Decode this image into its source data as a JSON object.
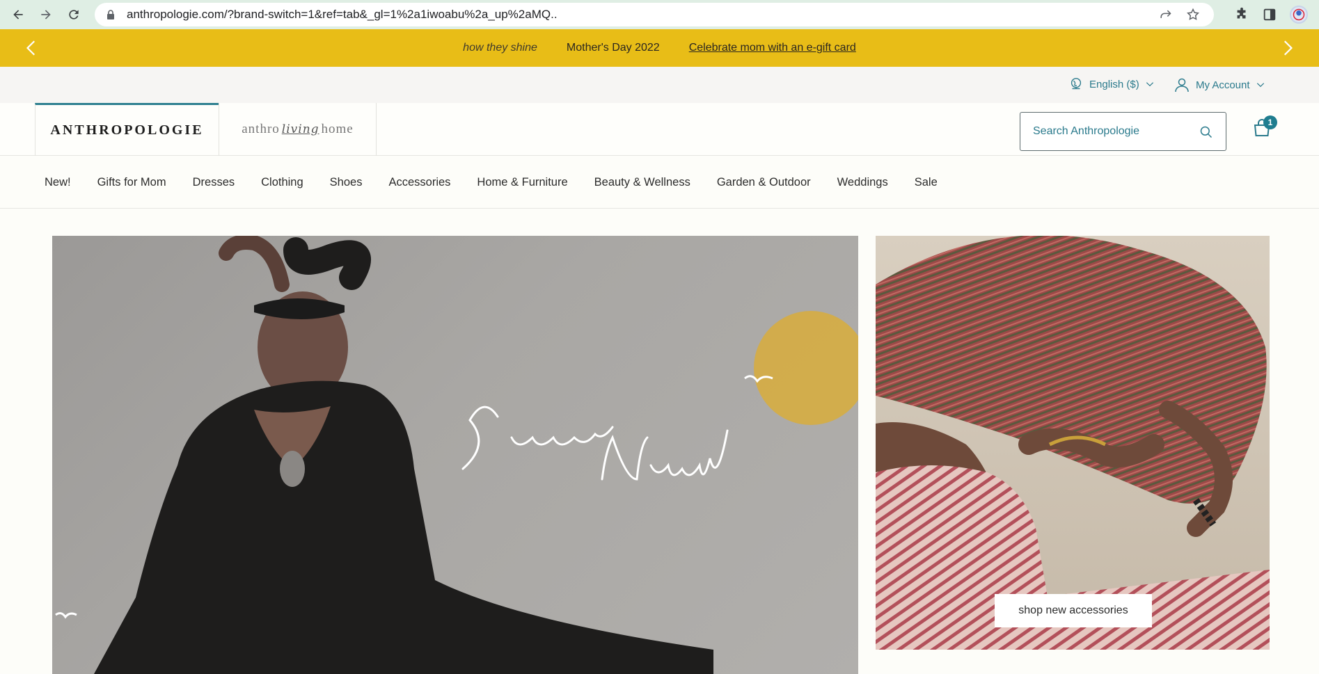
{
  "browser": {
    "url": "anthropologie.com/?brand-switch=1&ref=tab&_gl=1%2a1iwoabu%2a_up%2aMQ.."
  },
  "promo": {
    "items": [
      {
        "label": "how they shine"
      },
      {
        "label": "Mother's Day 2022"
      },
      {
        "label": "Celebrate mom with an e-gift card"
      }
    ]
  },
  "utility": {
    "language": "English ($)",
    "account": "My Account"
  },
  "header": {
    "brand_primary": "ANTHROPOLOGIE",
    "brand_secondary_left": "anthro",
    "brand_secondary_mid": "living",
    "brand_secondary_right": "home",
    "search_placeholder": "Search Anthropologie",
    "cart_count": "1"
  },
  "nav": {
    "items": [
      {
        "label": "New!"
      },
      {
        "label": "Gifts for Mom"
      },
      {
        "label": "Dresses"
      },
      {
        "label": "Clothing"
      },
      {
        "label": "Shoes"
      },
      {
        "label": "Accessories"
      },
      {
        "label": "Home & Furniture"
      },
      {
        "label": "Beauty & Wellness"
      },
      {
        "label": "Garden & Outdoor"
      },
      {
        "label": "Weddings"
      },
      {
        "label": "Sale"
      }
    ]
  },
  "hero": {
    "side_cta": "shop new accessories"
  },
  "colors": {
    "promo_bg": "#e8bd17",
    "accent_teal": "#2a7a8c",
    "chrome_bg": "#dfeee4"
  }
}
